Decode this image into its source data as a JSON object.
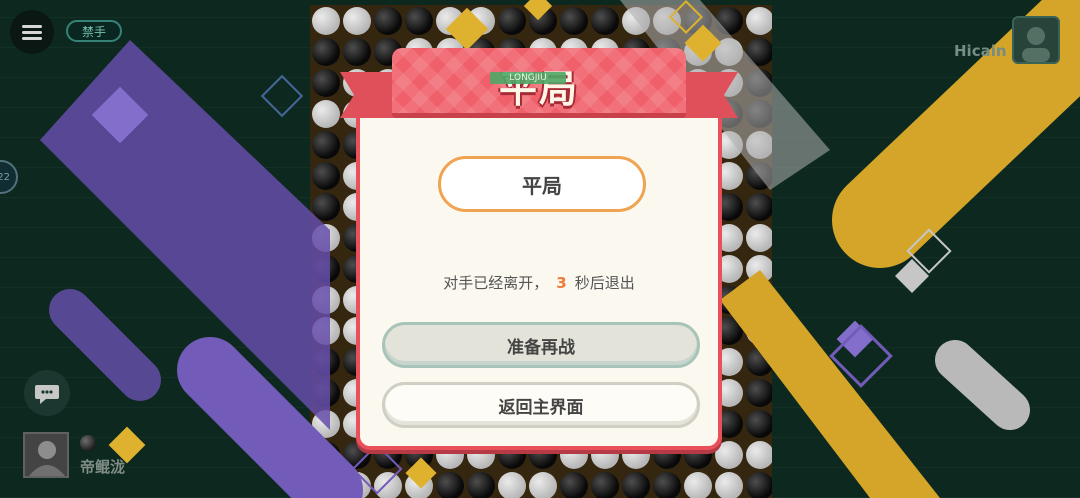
{
  "colors": {
    "accent_red": "#e9505a",
    "result_border": "#f0a350",
    "countdown_highlight": "#f07a3a",
    "stripe_purple": "#7d63c9",
    "stripe_gold": "#e6b32c",
    "background": "#0f2d22"
  },
  "top_bar": {
    "menu_icon": "menu-icon",
    "forbidden_label": "禁手",
    "timer_value": "22"
  },
  "opponent": {
    "name": "Hicain",
    "stone": "black"
  },
  "player": {
    "name": "帝鲲泷",
    "stone": "black",
    "chat_icon": "chat-bubble-icon"
  },
  "dialog": {
    "title": "平局",
    "watermark": "LONGJIU",
    "result_label": "平局",
    "countdown_prefix": "对手已经离开，",
    "countdown_seconds": "3",
    "countdown_suffix": "秒后退出",
    "ready_button": "准备再战",
    "home_button": "返回主界面"
  }
}
